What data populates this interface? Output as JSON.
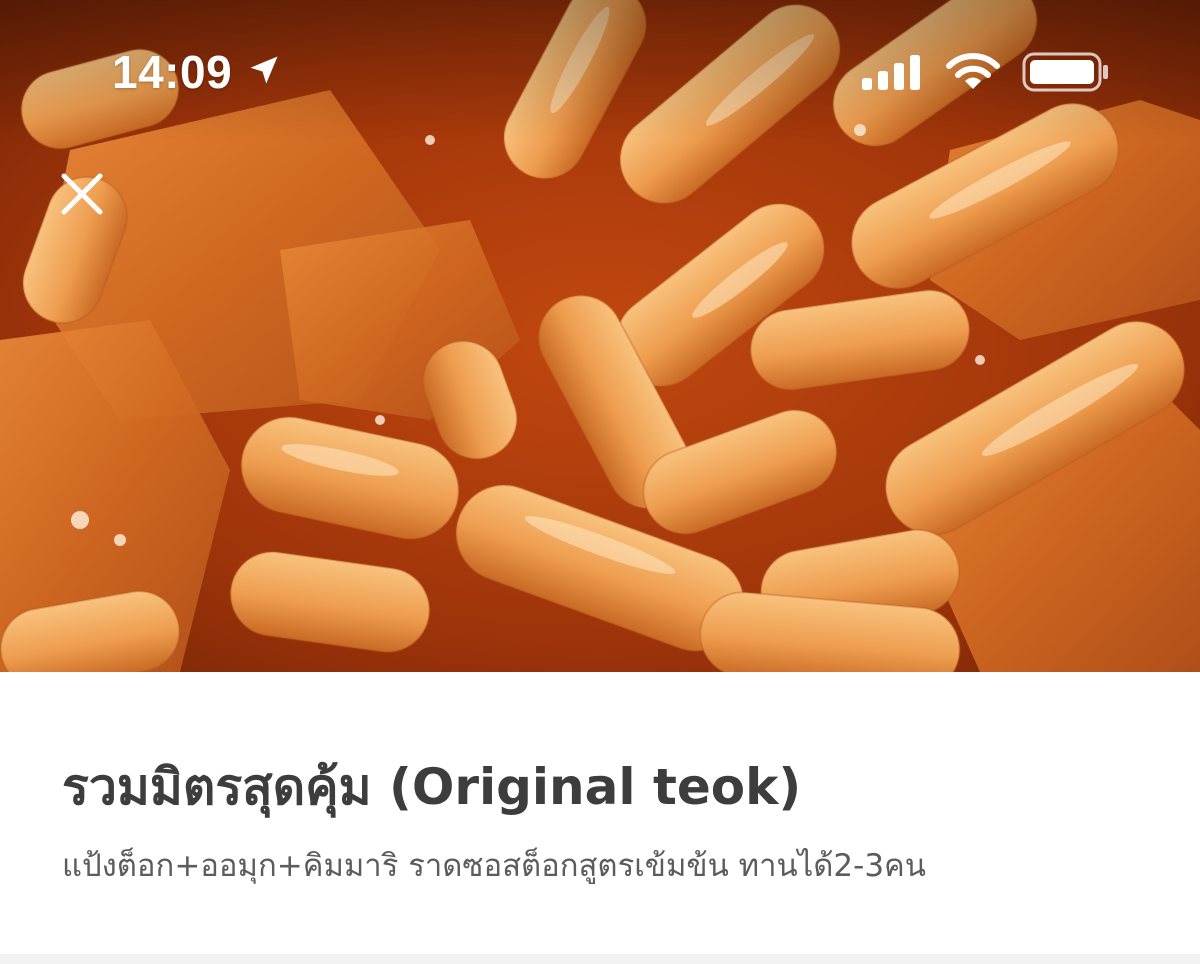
{
  "status_bar": {
    "time": "14:09",
    "icons": [
      "location-arrow-icon",
      "cellular-signal-icon",
      "wifi-icon",
      "battery-icon"
    ],
    "text_color": "#ffffff"
  },
  "hero": {
    "image_subject": "tteokbokki rice cakes and fish cakes in red sauce",
    "sauce_color": "#b8420f",
    "rice_cake_color": "#f0a35c"
  },
  "close_icon": "close-icon",
  "item": {
    "title": "รวมมิตรสุดคุ้ม (Original teok)",
    "description": "แป้งต็อก+ออมุก+คิมมาริ ราดซอสต็อกสูตรเข้มข้น ทานได้2-3คน",
    "title_color": "#3d3d3d",
    "description_color": "#5c5c5c"
  }
}
